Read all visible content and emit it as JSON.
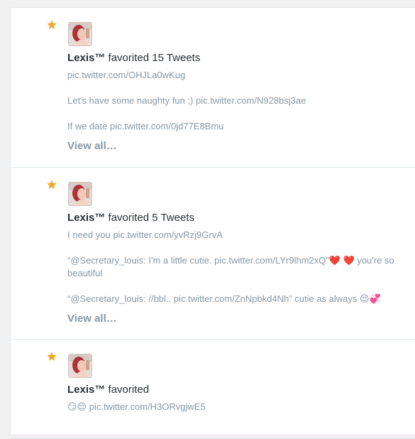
{
  "colors": {
    "star": "#f5a623",
    "link_gray": "#8899a6",
    "text_dark": "#292f33",
    "border": "#e1e8ed",
    "heart": "#d8252f"
  },
  "activities": [
    {
      "icon": "star-icon",
      "user_name": "Lexis™",
      "action": " favorited 15 Tweets",
      "tweets": [
        "pic.twitter.com/OHJLa0wKug",
        "Let's have some naughty fun ;) pic.twitter.com/N928bsj3ae",
        "If we date pic.twitter.com/0jd77E8Bmu"
      ],
      "view_all": "View all…"
    },
    {
      "icon": "star-icon",
      "user_name": "Lexis™",
      "action": " favorited 5 Tweets",
      "tweets": [
        "I need you pic.twitter.com/yvRzj9GrvA",
        "“@Secretary_louis: I'm a little cutie. pic.twitter.com/LYr9lhm2xQ”❤️ ❤️  you're so beautiful",
        "“@Secretary_louis: //bbl.. pic.twitter.com/ZnNpbkd4Nh” cutie as always 😌💞"
      ],
      "view_all": "View all…"
    },
    {
      "icon": "star-icon",
      "user_name": "Lexis™",
      "action": " favorited",
      "tweets": [
        "😏😌 pic.twitter.com/H3ORvgjwE5"
      ]
    }
  ]
}
